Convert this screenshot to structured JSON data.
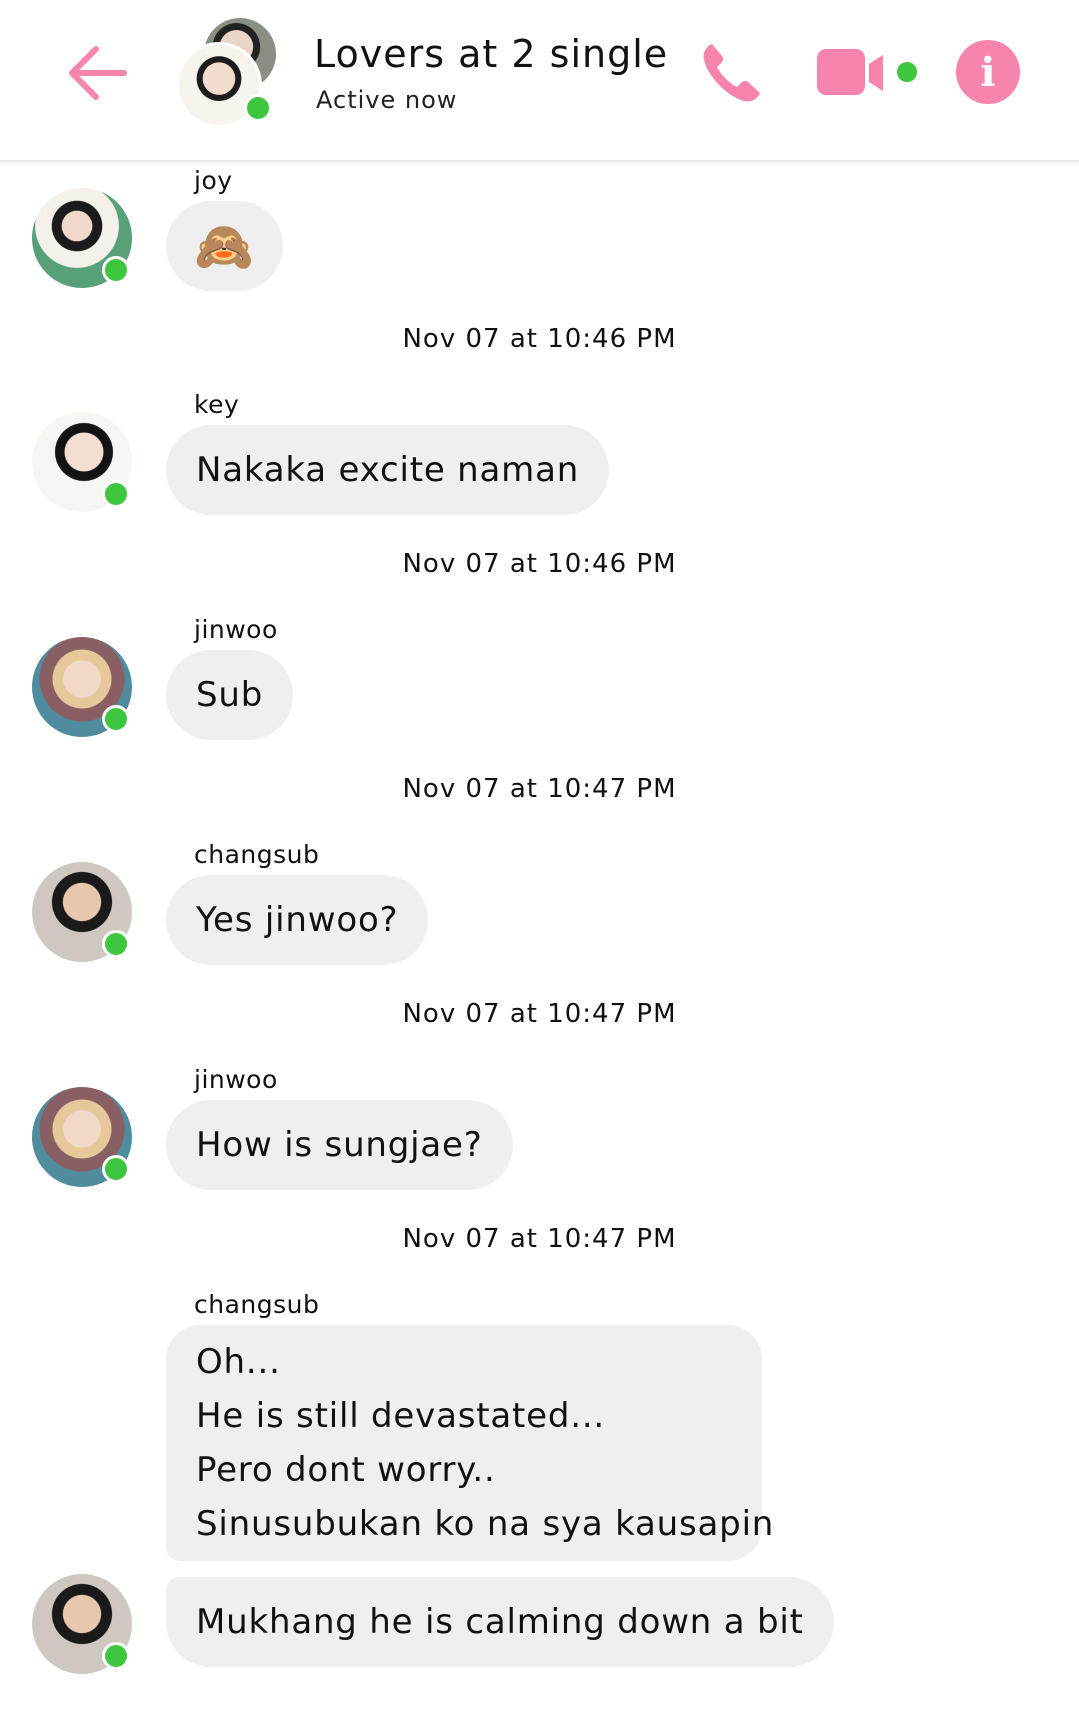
{
  "header": {
    "title": "Lovers at 2 single",
    "status": "Active now",
    "accent_color": "#f784ac",
    "online_color": "#3ec63f",
    "back_icon": "arrow-left-icon",
    "call_icon": "phone-icon",
    "video_icon": "video-camera-icon",
    "info_icon": "info-icon",
    "info_glyph": "i"
  },
  "messages": [
    {
      "sender": "joy",
      "text": "🙈",
      "avatar": "avatar-joy"
    },
    {
      "timestamp": "Nov 07 at 10:46 PM"
    },
    {
      "sender": "key",
      "text": "Nakaka excite naman",
      "avatar": "avatar-key"
    },
    {
      "timestamp": "Nov 07 at 10:46 PM"
    },
    {
      "sender": "jinwoo",
      "text": "Sub",
      "avatar": "avatar-jinwoo"
    },
    {
      "timestamp": "Nov 07 at 10:47 PM"
    },
    {
      "sender": "changsub",
      "text": "Yes jinwoo?",
      "avatar": "avatar-changsub"
    },
    {
      "timestamp": "Nov 07 at 10:47 PM"
    },
    {
      "sender": "jinwoo",
      "text": "How is sungjae?",
      "avatar": "avatar-jinwoo"
    },
    {
      "timestamp": "Nov 07 at 10:47 PM"
    },
    {
      "sender": "changsub",
      "lines": [
        "Oh...",
        "He is still devastated...",
        "Pero dont worry..",
        "Sinusubukan ko na sya kausapin"
      ],
      "avatar": "avatar-changsub"
    },
    {
      "text": "Mukhang he is calming down a bit",
      "avatar": "avatar-changsub"
    }
  ]
}
